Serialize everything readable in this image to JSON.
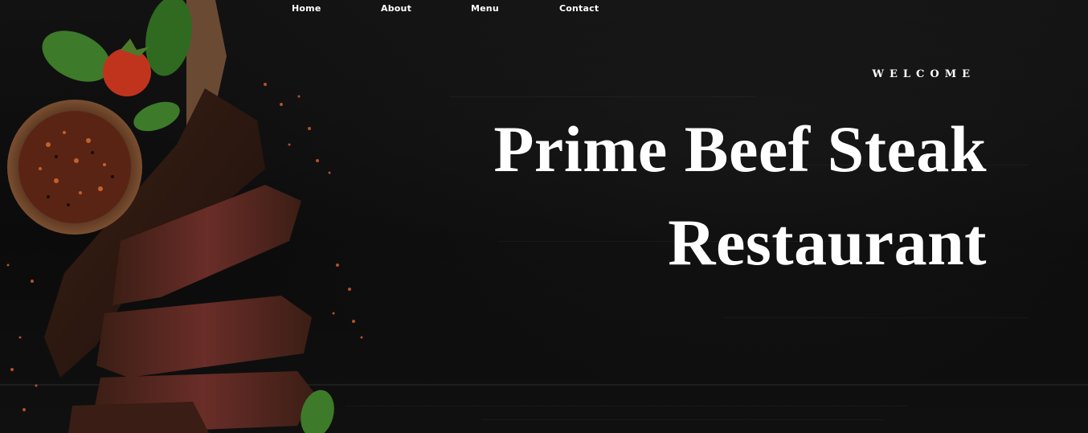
{
  "nav": {
    "items": [
      {
        "label": "Home"
      },
      {
        "label": "About"
      },
      {
        "label": "Menu"
      },
      {
        "label": "Contact"
      }
    ]
  },
  "hero": {
    "eyebrow": "WELCOME",
    "title_line_1": "Prime Beef Steak",
    "title_line_2": "Restaurant"
  },
  "colors": {
    "background": "#0d0d0d",
    "text": "#ffffff",
    "meat": "#5a2e22",
    "basil": "#3d7a2a",
    "tomato": "#c0341d"
  },
  "icons": {
    "hero_image": "steak-with-spices-image"
  }
}
